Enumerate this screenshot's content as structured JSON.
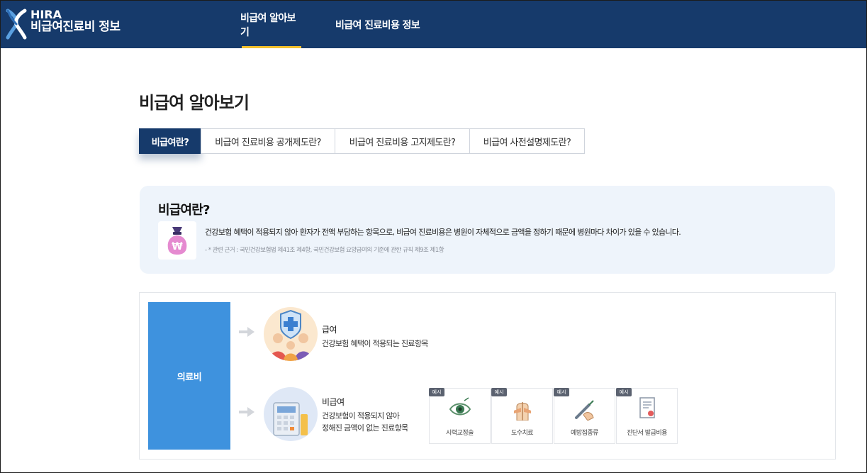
{
  "header": {
    "brand_line1": "HIRA",
    "brand_line2": "비급여진료비 정보",
    "nav": [
      {
        "label": "비급여 알아보기",
        "active": true
      },
      {
        "label": "비급여 진료비용 정보",
        "active": false
      }
    ]
  },
  "page_title": "비급여 알아보기",
  "tabs": [
    {
      "label": "비급여란?",
      "active": true
    },
    {
      "label": "비급여 진료비용 공개제도란?",
      "active": false
    },
    {
      "label": "비급여 진료비용 고지제도란?",
      "active": false
    },
    {
      "label": "비급여 사전설명제도란?",
      "active": false
    }
  ],
  "info": {
    "title": "비급여란?",
    "icon": "money-bag-icon",
    "description": "건강보험 혜택이 적용되지 않아 환자가 전액 부담하는 항목으로, 비급여 진료비용은 병원이 자체적으로 금액을 정하기 때문에 병원마다 차이가 있을 수 있습니다.",
    "reference": "- * 관련 근거 : 국민건강보험법 제41조 제4항, 국민건강보험 요양급여의 기준에 관한 규칙 제9조 제1항"
  },
  "diagram": {
    "root_label": "의료비",
    "covered": {
      "title": "급여",
      "desc": "건강보험 혜택이 적용되는 진료항목"
    },
    "noncovered": {
      "title": "비급여",
      "desc_line1": "건강보험이 적용되지 않아",
      "desc_line2": "정해진 금액이 없는 진료항목"
    },
    "example_badge": "예시",
    "examples": [
      {
        "label": "시력교정술",
        "icon": "eye-icon"
      },
      {
        "label": "도수치료",
        "icon": "manual-therapy-icon"
      },
      {
        "label": "예방접종류",
        "icon": "injection-icon"
      },
      {
        "label": "진단서 발급비용",
        "icon": "certificate-icon"
      }
    ]
  },
  "colors": {
    "header_bg": "#163a6b",
    "nav_active_underline": "#f3c12d",
    "root_box": "#3e92de",
    "info_bg": "#eef4fb"
  }
}
